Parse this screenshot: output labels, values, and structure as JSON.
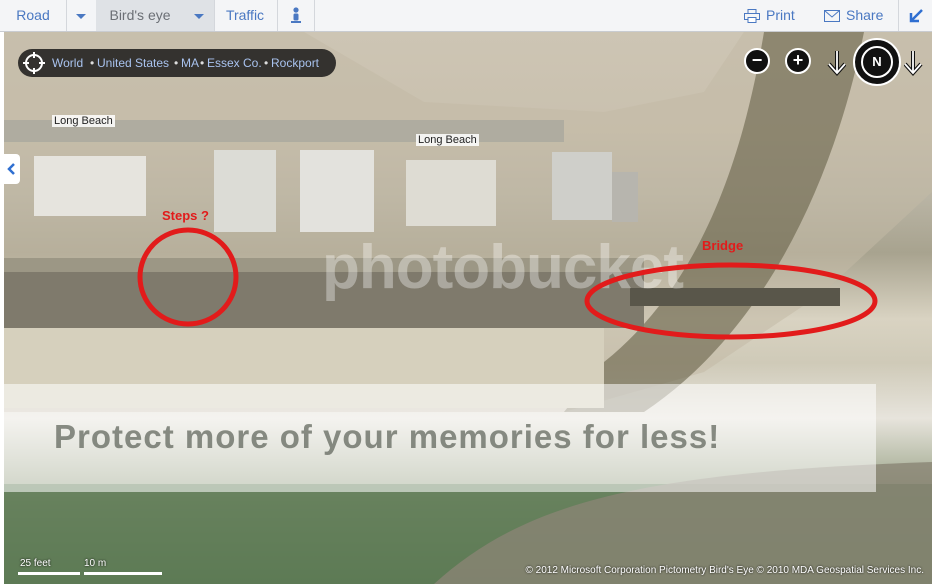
{
  "toolbar": {
    "road_label": "Road",
    "birds_eye_label": "Bird's eye",
    "traffic_label": "Traffic",
    "print_label": "Print",
    "share_label": "Share"
  },
  "breadcrumb": {
    "world": "World",
    "country": "United States",
    "state": "MA",
    "county": "Essex Co.",
    "city": "Rockport"
  },
  "map": {
    "street_label_1": "Long Beach",
    "street_label_2": "Long Beach",
    "annotation_steps": "Steps ?",
    "annotation_bridge": "Bridge",
    "compass_label": "N",
    "zoom_out_symbol": "−",
    "zoom_in_symbol": "+",
    "watermark_text": "Protect more of your memories for less!",
    "photobucket_watermark": "photobucket",
    "scale_feet": "25 feet",
    "scale_meters": "10 m",
    "copyright": "© 2012 Microsoft Corporation   Pictometry Bird's Eye © 2010 MDA Geospatial Services Inc."
  },
  "colors": {
    "link": "#4a78c2",
    "annotation_red": "#e21b1b",
    "toolbar_bg": "#f4f5f7"
  }
}
